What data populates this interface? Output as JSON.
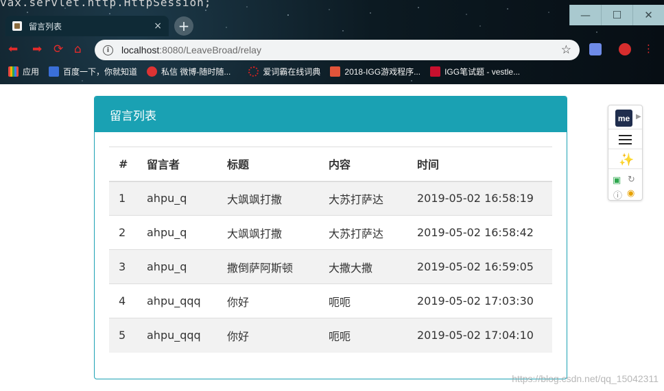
{
  "terminal_text": "vax.servlet.http.HttpSession;",
  "window_controls": {
    "minimize": "—",
    "maximize": "☐",
    "close": "✕"
  },
  "tab": {
    "title": "留言列表",
    "close": "×",
    "new_tab": "+"
  },
  "address_bar": {
    "host": "localhost",
    "port": ":8080",
    "path": "/LeaveBroad/relay"
  },
  "bookmarks": [
    {
      "label": "应用",
      "color": "#e6a23c"
    },
    {
      "label": "百度一下，你就知道",
      "color": "#3a6fd8"
    },
    {
      "label": "私信 微博-随时随...",
      "color": "#d33"
    },
    {
      "label": "爱词霸在线词典",
      "color": "#c22"
    },
    {
      "label": "2018-IGG游戏程序...",
      "color": "#e0543a"
    },
    {
      "label": "IGG笔试题 - vestle...",
      "color": "#c8102e"
    }
  ],
  "panel": {
    "heading": "留言列表",
    "columns": [
      "#",
      "留言者",
      "标题",
      "内容",
      "时间"
    ],
    "rows": [
      {
        "num": "1",
        "user": "ahpu_q",
        "title": "大飒飒打撒",
        "content": "大苏打萨达",
        "time": "2019-05-02 16:58:19"
      },
      {
        "num": "2",
        "user": "ahpu_q",
        "title": "大飒飒打撒",
        "content": "大苏打萨达",
        "time": "2019-05-02 16:58:42"
      },
      {
        "num": "3",
        "user": "ahpu_q",
        "title": "撒倒萨阿斯顿",
        "content": "大撒大撒",
        "time": "2019-05-02 16:59:05"
      },
      {
        "num": "4",
        "user": "ahpu_qqq",
        "title": "你好",
        "content": "呃呃",
        "time": "2019-05-02 17:03:30"
      },
      {
        "num": "5",
        "user": "ahpu_qqq",
        "title": "你好",
        "content": "呃呃",
        "time": "2019-05-02 17:04:10"
      }
    ]
  },
  "widget": {
    "badge": "me"
  },
  "watermark": "https://blog.csdn.net/qq_15042311",
  "colors": {
    "panel_accent": "#1aa1b3",
    "stripe": "#f2f2f2",
    "nav_icons": "#e32b2b"
  }
}
